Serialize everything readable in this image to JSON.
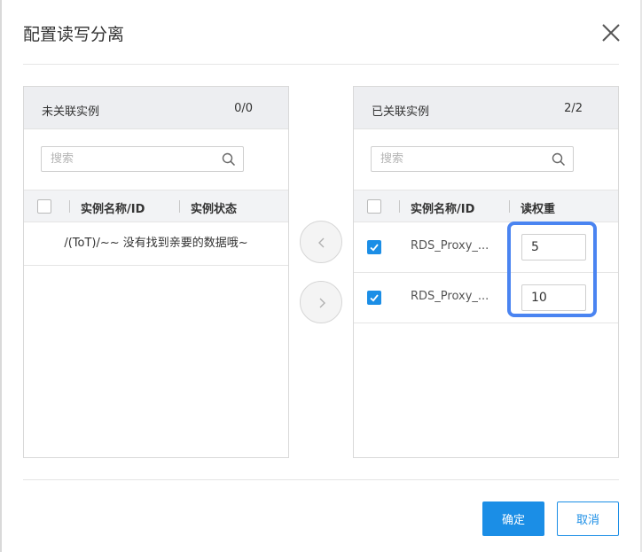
{
  "dialog": {
    "title": "配置读写分离",
    "confirm_label": "确定",
    "cancel_label": "取消"
  },
  "left_panel": {
    "title": "未关联实例",
    "count": "0/0",
    "search_placeholder": "搜索",
    "columns": [
      "实例名称/ID",
      "实例状态"
    ],
    "empty_text": "/(ToT)/~~ 没有找到亲要的数据哦~"
  },
  "right_panel": {
    "title": "已关联实例",
    "count": "2/2",
    "search_placeholder": "搜索",
    "columns": [
      "实例名称/ID",
      "读权重"
    ],
    "rows": [
      {
        "name": "RDS_Proxy_...",
        "weight": "5",
        "checked": true
      },
      {
        "name": "RDS_Proxy_...",
        "weight": "10",
        "checked": true
      }
    ]
  },
  "colors": {
    "accent": "#1b8ee6",
    "highlight": "#4a84f1"
  }
}
